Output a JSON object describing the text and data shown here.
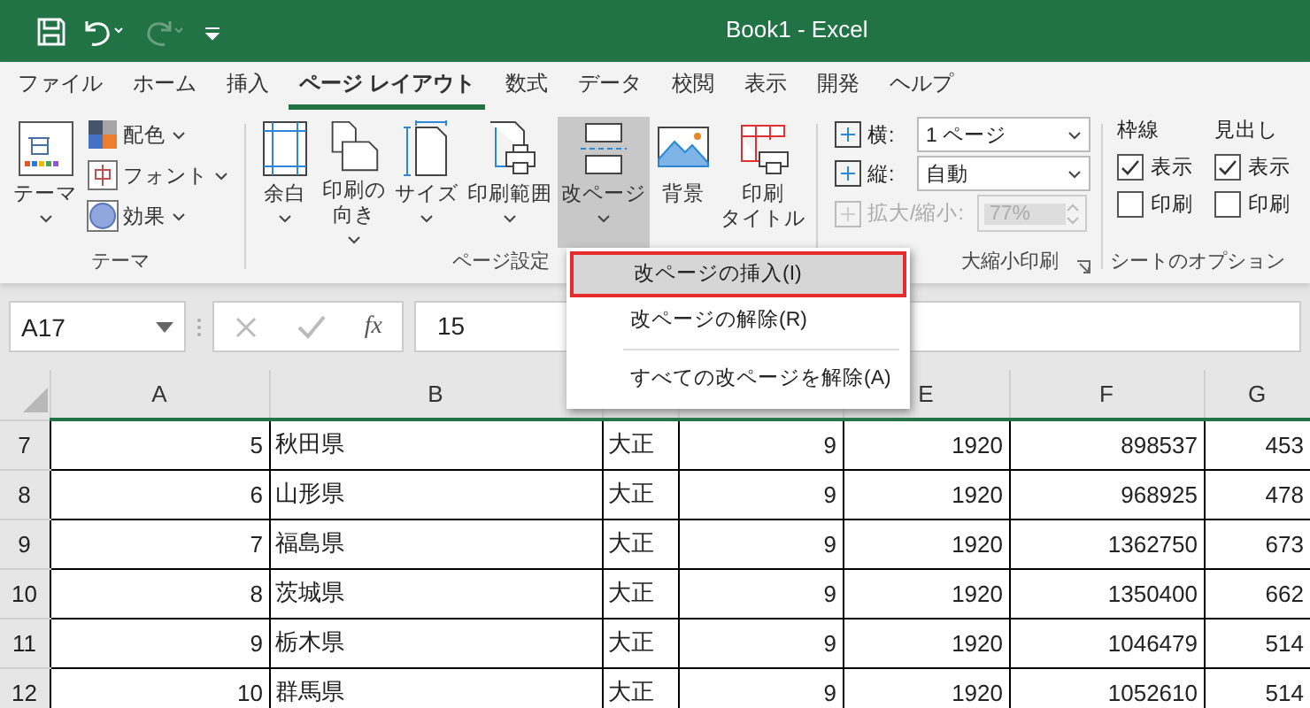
{
  "window": {
    "title": "Book1  -  Excel"
  },
  "tabs": [
    {
      "label": "ファイル",
      "selected": false
    },
    {
      "label": "ホーム",
      "selected": false
    },
    {
      "label": "挿入",
      "selected": false
    },
    {
      "label": "ページ レイアウト",
      "selected": true
    },
    {
      "label": "数式",
      "selected": false
    },
    {
      "label": "データ",
      "selected": false
    },
    {
      "label": "校閲",
      "selected": false
    },
    {
      "label": "表示",
      "selected": false
    },
    {
      "label": "開発",
      "selected": false
    },
    {
      "label": "ヘルプ",
      "selected": false
    }
  ],
  "theme_group": {
    "label": "テーマ",
    "big_button": "テーマ",
    "items": [
      "配色",
      "フォント",
      "効果"
    ]
  },
  "page_setup_group": {
    "label": "ページ設定",
    "buttons": [
      {
        "lines": [
          "余白"
        ],
        "dropdown": true,
        "pressed": false
      },
      {
        "lines": [
          "印刷の",
          "向き"
        ],
        "dropdown": true,
        "pressed": false
      },
      {
        "lines": [
          "サイズ"
        ],
        "dropdown": true,
        "pressed": false
      },
      {
        "lines": [
          "印刷範囲"
        ],
        "dropdown": true,
        "pressed": false
      },
      {
        "lines": [
          "改ページ"
        ],
        "dropdown": true,
        "pressed": true
      },
      {
        "lines": [
          "背景"
        ],
        "dropdown": false,
        "pressed": false
      },
      {
        "lines": [
          "印刷",
          "タイトル"
        ],
        "dropdown": false,
        "pressed": false
      }
    ]
  },
  "scale_group": {
    "label": "大縮小印刷",
    "rows": [
      {
        "label": "横:",
        "value": "1 ページ",
        "kind": "select",
        "disabled": false
      },
      {
        "label": "縦:",
        "value": "自動",
        "kind": "select",
        "disabled": false
      },
      {
        "label": "拡大/縮小:",
        "value": "77%",
        "kind": "spin",
        "disabled": true
      }
    ]
  },
  "sheet_options_group": {
    "label": "シートのオプション",
    "columns": [
      {
        "title": "枠線",
        "options": [
          {
            "label": "表示",
            "checked": true
          },
          {
            "label": "印刷",
            "checked": false
          }
        ]
      },
      {
        "title": "見出し",
        "options": [
          {
            "label": "表示",
            "checked": true
          },
          {
            "label": "印刷",
            "checked": false
          }
        ]
      }
    ]
  },
  "formula_bar": {
    "name_box": "A17",
    "function_label": "fx",
    "value": "15"
  },
  "sheet": {
    "columns": [
      "A",
      "B",
      null,
      null,
      "E",
      "F",
      "G"
    ],
    "rows": [
      {
        "header": "7",
        "cells": [
          "5",
          "秋田県",
          "大正",
          "9",
          "1920",
          "898537",
          "453"
        ]
      },
      {
        "header": "8",
        "cells": [
          "6",
          "山形県",
          "大正",
          "9",
          "1920",
          "968925",
          "478"
        ]
      },
      {
        "header": "9",
        "cells": [
          "7",
          "福島県",
          "大正",
          "9",
          "1920",
          "1362750",
          "673"
        ]
      },
      {
        "header": "10",
        "cells": [
          "8",
          "茨城県",
          "大正",
          "9",
          "1920",
          "1350400",
          "662"
        ]
      },
      {
        "header": "11",
        "cells": [
          "9",
          "栃木県",
          "大正",
          "9",
          "1920",
          "1046479",
          "514"
        ]
      },
      {
        "header": "12",
        "cells": [
          "10",
          "群馬県",
          "大正",
          "9",
          "1920",
          "1052610",
          "514"
        ]
      }
    ]
  },
  "dropdown_menu": {
    "items": [
      {
        "label": "改ページの挿入(I)",
        "selected": true,
        "separator_before": false
      },
      {
        "label": "改ページの解除(R)",
        "selected": false,
        "separator_before": false
      },
      {
        "label": "すべての改ページを解除(A)",
        "selected": false,
        "separator_before": true
      }
    ]
  }
}
